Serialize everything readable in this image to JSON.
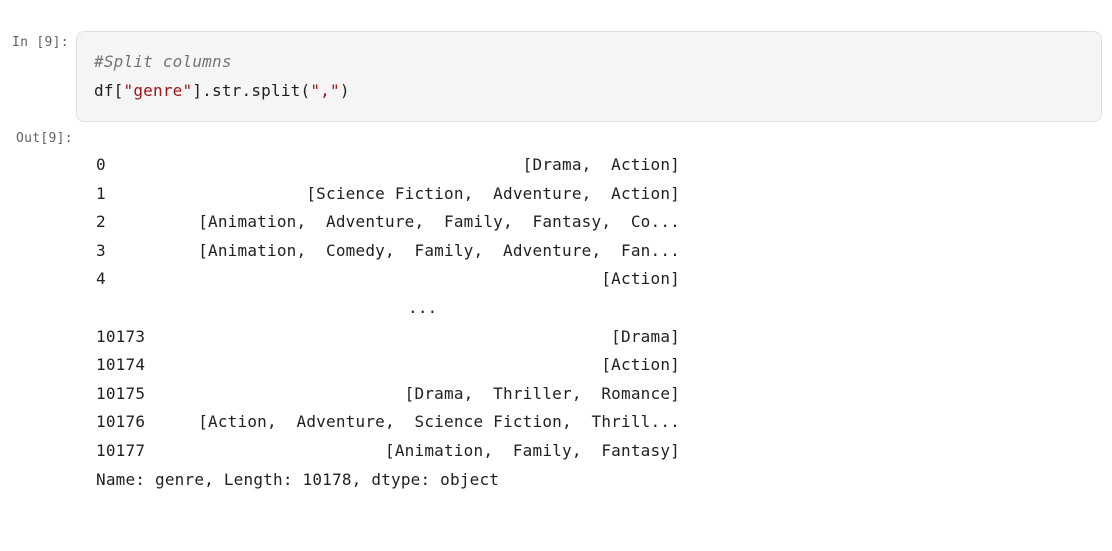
{
  "input_prompt": "In [9]:",
  "output_prompt": "Out[9]:",
  "code": {
    "comment": "#Split columns",
    "line_prefix": "df[",
    "string1": "\"genre\"",
    "line_mid": "].str.split(",
    "string2": "\",\"",
    "line_suffix": ")"
  },
  "output": {
    "rows": [
      {
        "index": "0",
        "value": "[Drama,  Action]"
      },
      {
        "index": "1",
        "value": "[Science Fiction,  Adventure,  Action]"
      },
      {
        "index": "2",
        "value": "[Animation,  Adventure,  Family,  Fantasy,  Co..."
      },
      {
        "index": "3",
        "value": "[Animation,  Comedy,  Family,  Adventure,  Fan..."
      },
      {
        "index": "4",
        "value": "[Action]"
      },
      {
        "index": "",
        "value": "..."
      },
      {
        "index": "10173",
        "value": "[Drama]"
      },
      {
        "index": "10174",
        "value": "[Action]"
      },
      {
        "index": "10175",
        "value": "[Drama,  Thriller,  Romance]"
      },
      {
        "index": "10176",
        "value": "[Action,  Adventure,  Science Fiction,  Thrill..."
      },
      {
        "index": "10177",
        "value": "[Animation,  Family,  Fantasy]"
      }
    ],
    "footer": "Name: genre, Length: 10178, dtype: object"
  }
}
